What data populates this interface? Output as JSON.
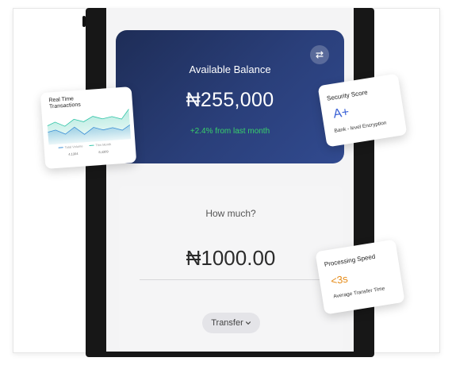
{
  "balance": {
    "title": "Available Balance",
    "amount": "₦255,000",
    "change": "+2.4% from last month"
  },
  "transfer": {
    "prompt": "How much?",
    "amount": "₦1000.00",
    "button_label": "Transfer",
    "button_icon": "chevron-down-icon"
  },
  "cards": {
    "realtime": {
      "title": "Real Time Transactions",
      "legend_a": "Total Volume",
      "legend_b": "This Month",
      "value_a": "4,1304",
      "value_b": "8,4309"
    },
    "security": {
      "title": "Security Score",
      "grade": "A+",
      "description": "Bank - level Encryption"
    },
    "processing": {
      "title": "Processing Speed",
      "time": "<3s",
      "description": "Average Transfer Time"
    }
  },
  "colors": {
    "card_gradient_start": "#1e2d57",
    "card_gradient_end": "#314a8f",
    "positive": "#38d16a",
    "accent_blue": "#3b62d6",
    "accent_orange": "#e58b18",
    "chart_series_a": "#3a8fd6",
    "chart_series_b": "#2ec4a6"
  }
}
